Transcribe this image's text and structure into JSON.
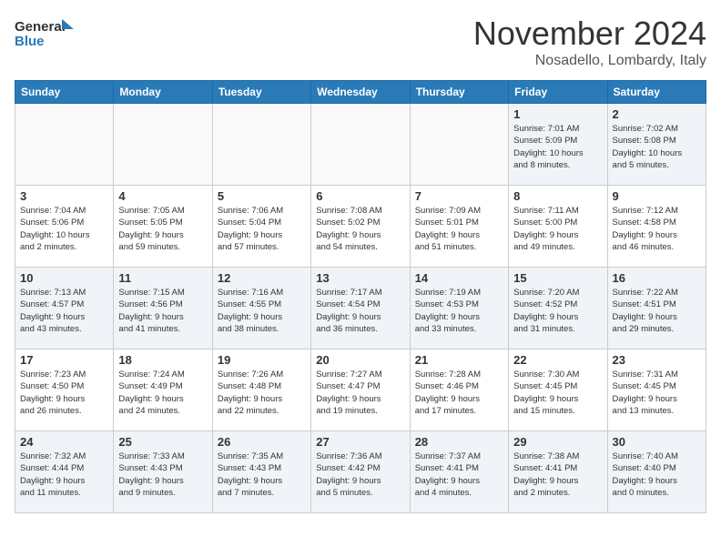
{
  "header": {
    "logo_line1": "General",
    "logo_line2": "Blue",
    "month": "November 2024",
    "location": "Nosadello, Lombardy, Italy"
  },
  "days_of_week": [
    "Sunday",
    "Monday",
    "Tuesday",
    "Wednesday",
    "Thursday",
    "Friday",
    "Saturday"
  ],
  "weeks": [
    [
      {
        "day": "",
        "info": ""
      },
      {
        "day": "",
        "info": ""
      },
      {
        "day": "",
        "info": ""
      },
      {
        "day": "",
        "info": ""
      },
      {
        "day": "",
        "info": ""
      },
      {
        "day": "1",
        "info": "Sunrise: 7:01 AM\nSunset: 5:09 PM\nDaylight: 10 hours\nand 8 minutes."
      },
      {
        "day": "2",
        "info": "Sunrise: 7:02 AM\nSunset: 5:08 PM\nDaylight: 10 hours\nand 5 minutes."
      }
    ],
    [
      {
        "day": "3",
        "info": "Sunrise: 7:04 AM\nSunset: 5:06 PM\nDaylight: 10 hours\nand 2 minutes."
      },
      {
        "day": "4",
        "info": "Sunrise: 7:05 AM\nSunset: 5:05 PM\nDaylight: 9 hours\nand 59 minutes."
      },
      {
        "day": "5",
        "info": "Sunrise: 7:06 AM\nSunset: 5:04 PM\nDaylight: 9 hours\nand 57 minutes."
      },
      {
        "day": "6",
        "info": "Sunrise: 7:08 AM\nSunset: 5:02 PM\nDaylight: 9 hours\nand 54 minutes."
      },
      {
        "day": "7",
        "info": "Sunrise: 7:09 AM\nSunset: 5:01 PM\nDaylight: 9 hours\nand 51 minutes."
      },
      {
        "day": "8",
        "info": "Sunrise: 7:11 AM\nSunset: 5:00 PM\nDaylight: 9 hours\nand 49 minutes."
      },
      {
        "day": "9",
        "info": "Sunrise: 7:12 AM\nSunset: 4:58 PM\nDaylight: 9 hours\nand 46 minutes."
      }
    ],
    [
      {
        "day": "10",
        "info": "Sunrise: 7:13 AM\nSunset: 4:57 PM\nDaylight: 9 hours\nand 43 minutes."
      },
      {
        "day": "11",
        "info": "Sunrise: 7:15 AM\nSunset: 4:56 PM\nDaylight: 9 hours\nand 41 minutes."
      },
      {
        "day": "12",
        "info": "Sunrise: 7:16 AM\nSunset: 4:55 PM\nDaylight: 9 hours\nand 38 minutes."
      },
      {
        "day": "13",
        "info": "Sunrise: 7:17 AM\nSunset: 4:54 PM\nDaylight: 9 hours\nand 36 minutes."
      },
      {
        "day": "14",
        "info": "Sunrise: 7:19 AM\nSunset: 4:53 PM\nDaylight: 9 hours\nand 33 minutes."
      },
      {
        "day": "15",
        "info": "Sunrise: 7:20 AM\nSunset: 4:52 PM\nDaylight: 9 hours\nand 31 minutes."
      },
      {
        "day": "16",
        "info": "Sunrise: 7:22 AM\nSunset: 4:51 PM\nDaylight: 9 hours\nand 29 minutes."
      }
    ],
    [
      {
        "day": "17",
        "info": "Sunrise: 7:23 AM\nSunset: 4:50 PM\nDaylight: 9 hours\nand 26 minutes."
      },
      {
        "day": "18",
        "info": "Sunrise: 7:24 AM\nSunset: 4:49 PM\nDaylight: 9 hours\nand 24 minutes."
      },
      {
        "day": "19",
        "info": "Sunrise: 7:26 AM\nSunset: 4:48 PM\nDaylight: 9 hours\nand 22 minutes."
      },
      {
        "day": "20",
        "info": "Sunrise: 7:27 AM\nSunset: 4:47 PM\nDaylight: 9 hours\nand 19 minutes."
      },
      {
        "day": "21",
        "info": "Sunrise: 7:28 AM\nSunset: 4:46 PM\nDaylight: 9 hours\nand 17 minutes."
      },
      {
        "day": "22",
        "info": "Sunrise: 7:30 AM\nSunset: 4:45 PM\nDaylight: 9 hours\nand 15 minutes."
      },
      {
        "day": "23",
        "info": "Sunrise: 7:31 AM\nSunset: 4:45 PM\nDaylight: 9 hours\nand 13 minutes."
      }
    ],
    [
      {
        "day": "24",
        "info": "Sunrise: 7:32 AM\nSunset: 4:44 PM\nDaylight: 9 hours\nand 11 minutes."
      },
      {
        "day": "25",
        "info": "Sunrise: 7:33 AM\nSunset: 4:43 PM\nDaylight: 9 hours\nand 9 minutes."
      },
      {
        "day": "26",
        "info": "Sunrise: 7:35 AM\nSunset: 4:43 PM\nDaylight: 9 hours\nand 7 minutes."
      },
      {
        "day": "27",
        "info": "Sunrise: 7:36 AM\nSunset: 4:42 PM\nDaylight: 9 hours\nand 5 minutes."
      },
      {
        "day": "28",
        "info": "Sunrise: 7:37 AM\nSunset: 4:41 PM\nDaylight: 9 hours\nand 4 minutes."
      },
      {
        "day": "29",
        "info": "Sunrise: 7:38 AM\nSunset: 4:41 PM\nDaylight: 9 hours\nand 2 minutes."
      },
      {
        "day": "30",
        "info": "Sunrise: 7:40 AM\nSunset: 4:40 PM\nDaylight: 9 hours\nand 0 minutes."
      }
    ]
  ]
}
